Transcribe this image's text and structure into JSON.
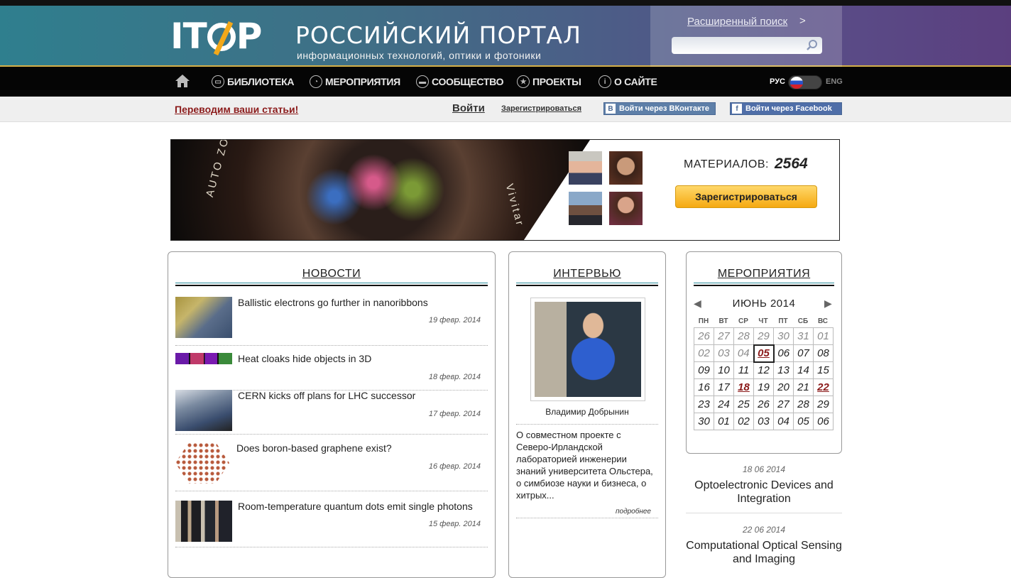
{
  "header": {
    "logo": "ITOP",
    "title": "РОССИЙСКИЙ ПОРТАЛ",
    "subtitle": "информационных технологий, оптики и фотоники",
    "advanced_search": "Расширенный поиск",
    "advanced_arrow": ">",
    "search_placeholder": ""
  },
  "nav": {
    "items": [
      {
        "label": "БИБЛИОТЕКА",
        "icon": "book-icon"
      },
      {
        "label": "МЕРОПРИЯТИЯ",
        "icon": "clock-icon"
      },
      {
        "label": "СООБЩЕСТВО",
        "icon": "chat-icon"
      },
      {
        "label": "ПРОЕКТЫ",
        "icon": "star-icon"
      },
      {
        "label": "О САЙТЕ",
        "icon": "info-icon"
      }
    ],
    "lang_rus": "РУС",
    "lang_eng": "ENG"
  },
  "subbar": {
    "translate": "Переводим ваши статьи!",
    "login": "Войти",
    "register": "Зарегистрироваться",
    "vk": "Войти через ВКонтакте",
    "fb": "Войти через Facebook"
  },
  "banner": {
    "lens_text_left": "AUTO ZOOM",
    "lens_text_right": "Vivitar",
    "materials_label": "МАТЕРИАЛОВ:",
    "materials_count": "2564",
    "register_button": "Зарегистрироваться"
  },
  "news": {
    "title": "НОВОСТИ",
    "items": [
      {
        "title": "Ballistic electrons go further in nanoribbons",
        "date": "19 февр. 2014"
      },
      {
        "title": "Heat cloaks hide objects in 3D",
        "date": "18 февр. 2014"
      },
      {
        "title": "CERN kicks off plans for LHC successor",
        "date": "17 февр. 2014"
      },
      {
        "title": "Does boron-based graphene exist?",
        "date": "16 февр. 2014"
      },
      {
        "title": "Room-temperature quantum dots emit single photons",
        "date": "15 февр. 2014"
      }
    ]
  },
  "interview": {
    "title": "ИНТЕРВЬЮ",
    "name": "Владимир Добрынин",
    "text": "О совместном проекте с Северо-Ирландской лабораторией инженерии знаний университета Ольстера, о симбиозе науки и бизнеса, о хитрых...",
    "more": "подробнее"
  },
  "events": {
    "title": "МЕРОПРИЯТИЯ",
    "month": "ИЮНЬ 2014",
    "dow": [
      "ПН",
      "ВТ",
      "СР",
      "ЧТ",
      "ПТ",
      "СБ",
      "ВС"
    ],
    "weeks": [
      [
        "26",
        "27",
        "28",
        "29",
        "30",
        "31",
        "01"
      ],
      [
        "02",
        "03",
        "04",
        "05",
        "06",
        "07",
        "08"
      ],
      [
        "09",
        "10",
        "11",
        "12",
        "13",
        "14",
        "15"
      ],
      [
        "16",
        "17",
        "18",
        "19",
        "20",
        "21",
        "22"
      ],
      [
        "23",
        "24",
        "25",
        "26",
        "27",
        "28",
        "29"
      ],
      [
        "30",
        "01",
        "02",
        "03",
        "04",
        "05",
        "06"
      ]
    ],
    "list": [
      {
        "date": "18 06 2014",
        "title": "Optoelectronic Devices and Integration"
      },
      {
        "date": "22 06 2014",
        "title": "Computational Optical Sensing and Imaging"
      }
    ]
  }
}
